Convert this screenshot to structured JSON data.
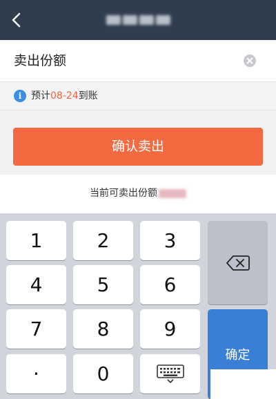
{
  "navbar": {
    "title": ""
  },
  "sell": {
    "input_text": "卖出份额",
    "info_prefix": "预计",
    "info_date": "08-24",
    "info_suffix": "到账",
    "confirm_label": "确认卖出",
    "available_label": "当前可卖出份额"
  },
  "keyboard": {
    "keys": [
      "1",
      "2",
      "3",
      "4",
      "5",
      "6",
      "7",
      "8",
      "9",
      "·",
      "0"
    ],
    "done_label": "确定"
  },
  "colors": {
    "navbar": "#2f3d4e",
    "accent": "#f36a40",
    "info": "#3a8fe3",
    "done_key": "#3a7fd6"
  }
}
